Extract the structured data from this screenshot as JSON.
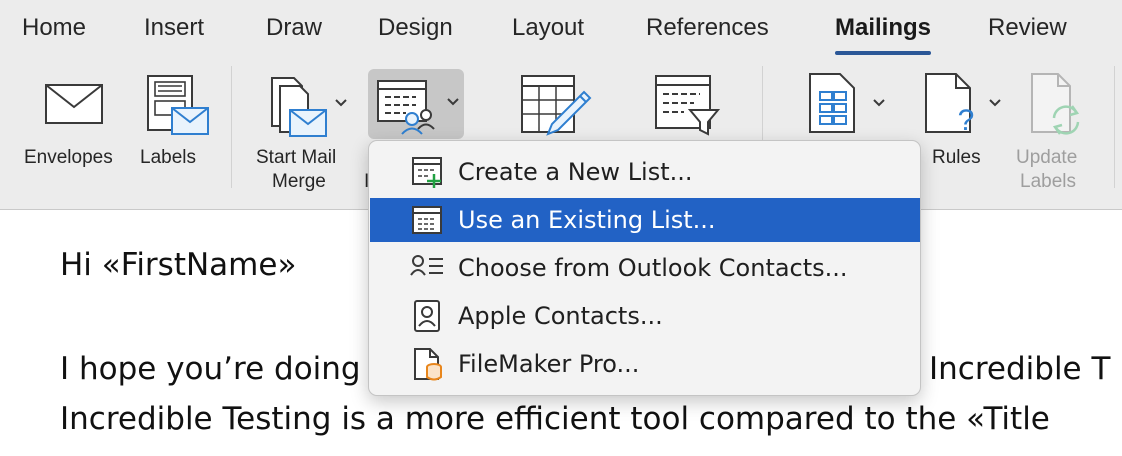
{
  "tabs": [
    {
      "label": "Home",
      "active": false
    },
    {
      "label": "Insert",
      "active": false
    },
    {
      "label": "Draw",
      "active": false
    },
    {
      "label": "Design",
      "active": false
    },
    {
      "label": "Layout",
      "active": false
    },
    {
      "label": "References",
      "active": false
    },
    {
      "label": "Mailings",
      "active": true
    },
    {
      "label": "Review",
      "active": false
    }
  ],
  "ribbon": {
    "envelopes_label": "Envelopes",
    "labels_label": "Labels",
    "start_mail_merge_line1": "Start Mail",
    "start_mail_merge_line2": "Merge",
    "partial_label_fragment": "I",
    "rules_label": "Rules",
    "update_labels_line1": "Update",
    "update_labels_line2": "Labels"
  },
  "menu": {
    "items": [
      {
        "label": "Create a New List...",
        "icon": "table-plus-icon",
        "selected": false
      },
      {
        "label": "Use an Existing List...",
        "icon": "table-icon",
        "selected": true
      },
      {
        "label": "Choose from Outlook Contacts...",
        "icon": "person-list-icon",
        "selected": false
      },
      {
        "label": "Apple Contacts...",
        "icon": "contacts-book-icon",
        "selected": false
      },
      {
        "label": "FileMaker Pro...",
        "icon": "database-file-icon",
        "selected": false
      }
    ]
  },
  "document": {
    "line1": "Hi «FirstName»",
    "line2_left": "I hope you’re doing",
    "line2_right": "Incredible T",
    "line3": "Incredible Testing is a more efficient tool compared to the «Title"
  },
  "colors": {
    "accent_blue": "#2262c5",
    "tab_underline": "#2b5797",
    "ribbon_bg": "#ececec",
    "icon_blue": "#2f7fd0"
  }
}
